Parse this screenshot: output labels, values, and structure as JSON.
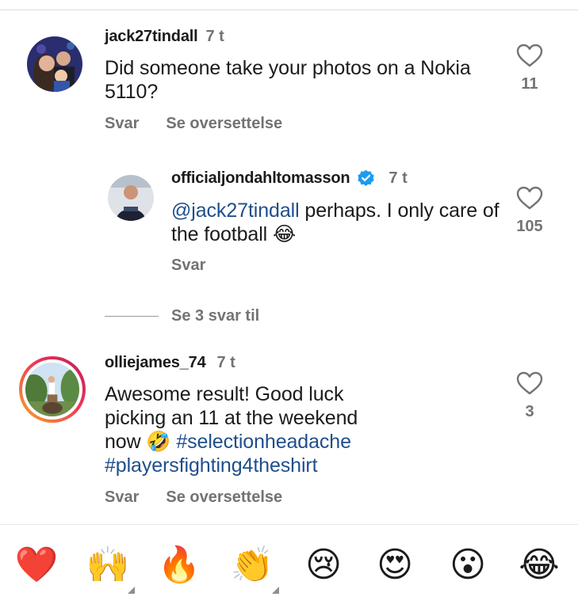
{
  "comments": [
    {
      "username": "jack27tindall",
      "time": "7 t",
      "text": "Did someone take your photos on a Nokia 5110?",
      "likes": "11",
      "actions": [
        "Svar",
        "Se oversettelse"
      ]
    },
    {
      "username": "officialjondahltomasson",
      "time": "7 t",
      "verified": true,
      "mention": "@jack27tindall",
      "text_rest": " perhaps. I only care of the football ",
      "emoji": "😂",
      "likes": "105",
      "actions": [
        "Svar"
      ]
    },
    {
      "username": "olliejames_74",
      "time": "7 t",
      "text_intro": "Awesome result! Good luck picking an 11 at the weekend now ",
      "emoji": "🤣",
      "hashtag1": "#selectionheadache",
      "hashtag2": "#playersfighting4theshirt",
      "likes": "3",
      "actions": [
        "Svar",
        "Se oversettelse"
      ]
    }
  ],
  "more_replies": "Se 3 svar til",
  "reactions": [
    "❤️",
    "🙌",
    "🔥",
    "👏",
    "😢",
    "😍",
    "😮",
    "😂"
  ],
  "colors": {
    "link": "#1f4e8c",
    "muted": "#737373",
    "verified": "#1d9bf0",
    "story_ring_start": "#f9a825",
    "story_ring_end": "#c2185b"
  }
}
